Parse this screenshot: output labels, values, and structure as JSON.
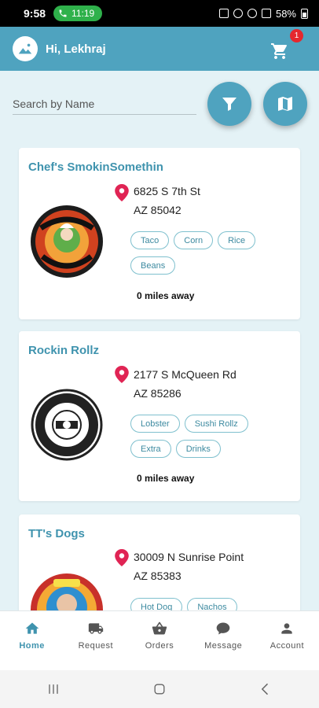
{
  "status_bar": {
    "time": "9:58",
    "call_duration": "11:19",
    "battery": "58%"
  },
  "app_bar": {
    "greeting": "Hi, Lekhraj",
    "cart_count": "1"
  },
  "search": {
    "placeholder": "Search by Name"
  },
  "restaurants": [
    {
      "name": "Chef's SmokinSomethin",
      "address_line1": "6825 S 7th St",
      "address_line2": "AZ 85042",
      "tags": [
        "Taco",
        "Corn",
        "Rice",
        "Beans"
      ],
      "distance": "0 miles away"
    },
    {
      "name": "Rockin Rollz",
      "address_line1": "2177 S McQueen Rd",
      "address_line2": "AZ 85286",
      "tags": [
        "Lobster",
        "Sushi Rollz",
        "Extra",
        "Drinks"
      ],
      "distance": "0 miles away"
    },
    {
      "name": "TT's Dogs",
      "address_line1": "30009 N Sunrise Point",
      "address_line2": "AZ 85383",
      "tags": [
        "Hot Dog",
        "Nachos"
      ],
      "distance": ""
    }
  ],
  "bottom_nav": [
    {
      "label": "Home",
      "icon": "home-icon",
      "active": true
    },
    {
      "label": "Request",
      "icon": "truck-icon",
      "active": false
    },
    {
      "label": "Orders",
      "icon": "basket-icon",
      "active": false
    },
    {
      "label": "Message",
      "icon": "chat-icon",
      "active": false
    },
    {
      "label": "Account",
      "icon": "person-icon",
      "active": false
    }
  ],
  "colors": {
    "primary": "#4fa3bf",
    "title": "#3f93ae",
    "badge": "#e5282e",
    "pin": "#e02454",
    "background": "#e4f2f6"
  }
}
